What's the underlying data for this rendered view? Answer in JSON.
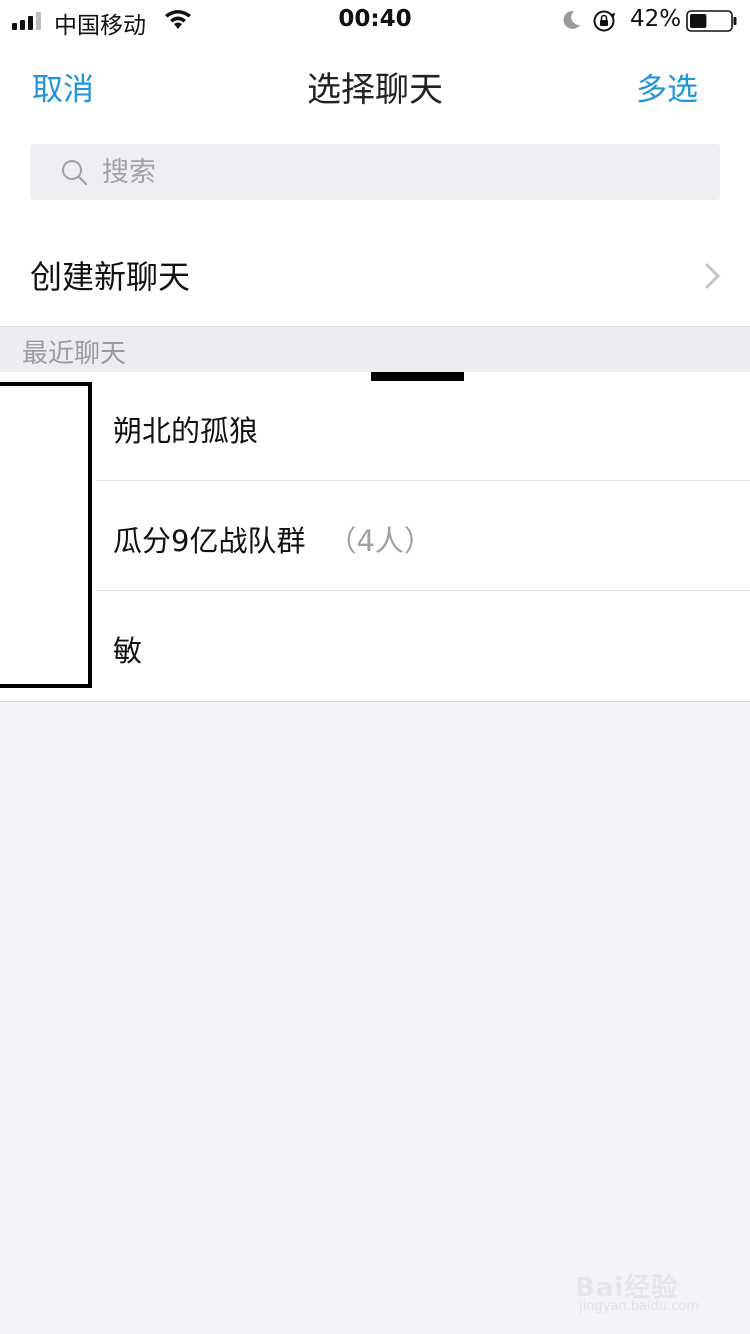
{
  "status_bar": {
    "carrier": "中国移动",
    "time": "00:40",
    "battery_percent": "42%",
    "battery_level": 0.42,
    "icons": [
      "signal-icon",
      "wifi-icon",
      "moon-icon",
      "orientation-lock-icon",
      "battery-icon"
    ]
  },
  "nav": {
    "cancel": "取消",
    "title": "选择聊天",
    "multi_select": "多选"
  },
  "search": {
    "placeholder": "搜索"
  },
  "create_chat": {
    "label": "创建新聊天"
  },
  "recent": {
    "header": "最近聊天",
    "items": [
      {
        "name": "朔北的孤狼",
        "count": ""
      },
      {
        "name": "瓜分9亿战队群",
        "count": "（4人）"
      },
      {
        "name": "敏",
        "count": ""
      }
    ]
  },
  "watermark": {
    "brand": "Bai经验",
    "url": "jingyan.baidu.com"
  },
  "colors": {
    "accent": "#1e96d7",
    "background": "#f4f3f8"
  }
}
